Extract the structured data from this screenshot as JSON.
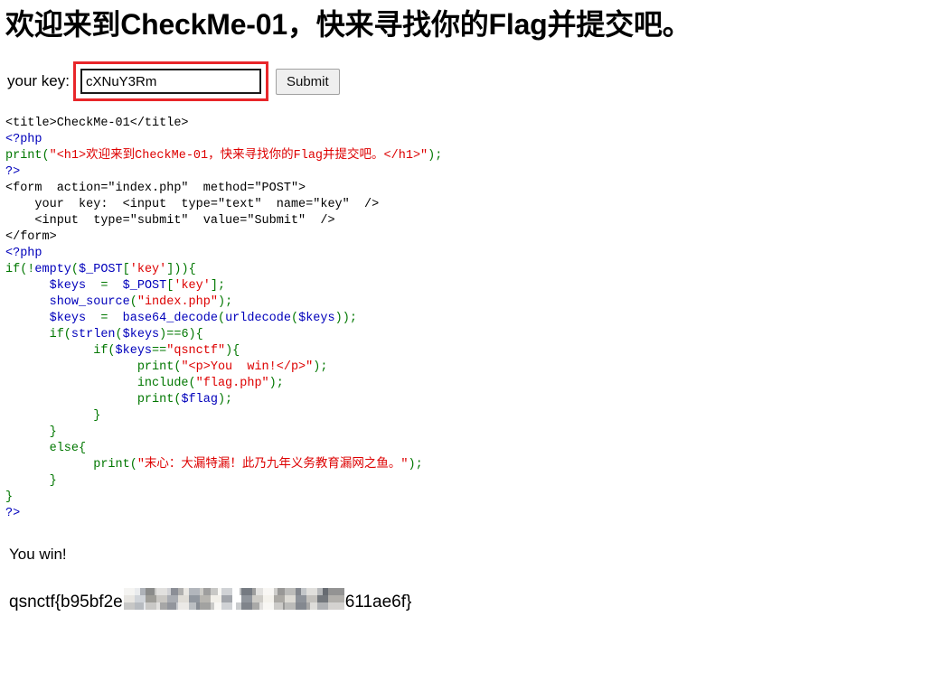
{
  "page": {
    "heading": "欢迎来到CheckMe-01，快来寻找你的Flag并提交吧。"
  },
  "form": {
    "label": "your key:",
    "input_value": "cXNuY3Rm",
    "input_placeholder": "",
    "submit_label": "Submit",
    "highlight_color": "#e8262a"
  },
  "source": {
    "colors": {
      "html": "#000000",
      "keyword": "#007700",
      "string": "#dd0000",
      "variable": "#0000bb",
      "tag": "#0000bb"
    },
    "lines": [
      [
        {
          "t": "<title>CheckMe-01</title>",
          "c": "html"
        }
      ],
      [
        {
          "t": "<?php",
          "c": "tag"
        }
      ],
      [
        {
          "t": "print(",
          "c": "kw"
        },
        {
          "t": "\"<h1>欢迎来到CheckMe-01，快来寻找你的Flag并提交吧。</h1>\"",
          "c": "str"
        },
        {
          "t": ");",
          "c": "kw"
        }
      ],
      [
        {
          "t": "?>",
          "c": "tag"
        }
      ],
      [
        {
          "t": "<form  action=\"index.php\"  method=\"POST\">",
          "c": "html"
        }
      ],
      [
        {
          "t": "    your  key:  <input  type=\"text\"  name=\"key\"  />",
          "c": "html"
        }
      ],
      [
        {
          "t": "    <input  type=\"submit\"  value=\"Submit\"  />",
          "c": "html"
        }
      ],
      [
        {
          "t": "</form>",
          "c": "html"
        }
      ],
      [
        {
          "t": "<?php",
          "c": "tag"
        }
      ],
      [
        {
          "t": "if(!",
          "c": "kw"
        },
        {
          "t": "empty",
          "c": "var"
        },
        {
          "t": "(",
          "c": "kw"
        },
        {
          "t": "$_POST",
          "c": "var"
        },
        {
          "t": "[",
          "c": "kw"
        },
        {
          "t": "'key'",
          "c": "str"
        },
        {
          "t": "])){",
          "c": "kw"
        }
      ],
      [
        {
          "t": "      ",
          "c": "kw"
        },
        {
          "t": "$keys",
          "c": "var"
        },
        {
          "t": "  =  ",
          "c": "kw"
        },
        {
          "t": "$_POST",
          "c": "var"
        },
        {
          "t": "[",
          "c": "kw"
        },
        {
          "t": "'key'",
          "c": "str"
        },
        {
          "t": "];",
          "c": "kw"
        }
      ],
      [
        {
          "t": "      ",
          "c": "kw"
        },
        {
          "t": "show_source",
          "c": "var"
        },
        {
          "t": "(",
          "c": "kw"
        },
        {
          "t": "\"index.php\"",
          "c": "str"
        },
        {
          "t": ");",
          "c": "kw"
        }
      ],
      [
        {
          "t": "      ",
          "c": "kw"
        },
        {
          "t": "$keys",
          "c": "var"
        },
        {
          "t": "  =  ",
          "c": "kw"
        },
        {
          "t": "base64_decode",
          "c": "var"
        },
        {
          "t": "(",
          "c": "kw"
        },
        {
          "t": "urldecode",
          "c": "var"
        },
        {
          "t": "(",
          "c": "kw"
        },
        {
          "t": "$keys",
          "c": "var"
        },
        {
          "t": "));",
          "c": "kw"
        }
      ],
      [
        {
          "t": "      if(",
          "c": "kw"
        },
        {
          "t": "strlen",
          "c": "var"
        },
        {
          "t": "(",
          "c": "kw"
        },
        {
          "t": "$keys",
          "c": "var"
        },
        {
          "t": ")==6){",
          "c": "kw"
        }
      ],
      [
        {
          "t": "            if(",
          "c": "kw"
        },
        {
          "t": "$keys",
          "c": "var"
        },
        {
          "t": "==",
          "c": "kw"
        },
        {
          "t": "\"qsnctf\"",
          "c": "str"
        },
        {
          "t": "){",
          "c": "kw"
        }
      ],
      [
        {
          "t": "                  print(",
          "c": "kw"
        },
        {
          "t": "\"<p>You  win!</p>\"",
          "c": "str"
        },
        {
          "t": ");",
          "c": "kw"
        }
      ],
      [
        {
          "t": "                  include(",
          "c": "kw"
        },
        {
          "t": "\"flag.php\"",
          "c": "str"
        },
        {
          "t": ");",
          "c": "kw"
        }
      ],
      [
        {
          "t": "                  print(",
          "c": "kw"
        },
        {
          "t": "$flag",
          "c": "var"
        },
        {
          "t": ");",
          "c": "kw"
        }
      ],
      [
        {
          "t": "            }",
          "c": "kw"
        }
      ],
      [
        {
          "t": "      }",
          "c": "kw"
        }
      ],
      [
        {
          "t": "      else{",
          "c": "kw"
        }
      ],
      [
        {
          "t": "            print(",
          "c": "kw"
        },
        {
          "t": "\"末心：大漏特漏！此乃九年义务教育漏网之鱼。\"",
          "c": "str"
        },
        {
          "t": ");",
          "c": "kw"
        }
      ],
      [
        {
          "t": "      }",
          "c": "kw"
        }
      ],
      [
        {
          "t": "}",
          "c": "kw"
        }
      ],
      [
        {
          "t": "?>",
          "c": "tag"
        }
      ]
    ]
  },
  "output": {
    "win_message": "You win!",
    "flag_prefix": "qsnctf{b95bf2e",
    "flag_redacted": true,
    "flag_suffix": "611ae6f}"
  }
}
